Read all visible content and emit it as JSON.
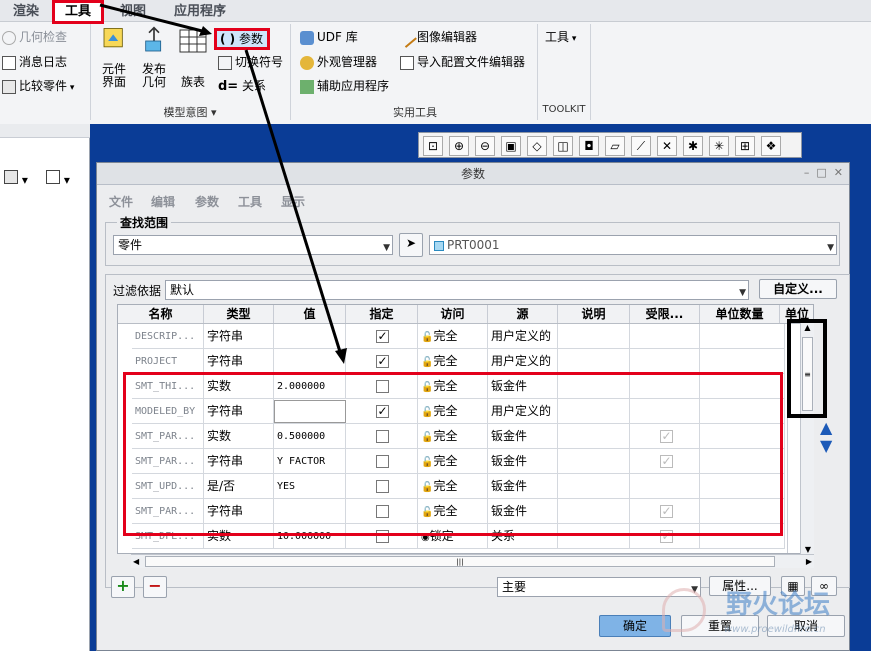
{
  "ribbon": {
    "tabs": [
      {
        "label": "渲染"
      },
      {
        "label": "工具"
      },
      {
        "label": "视图"
      },
      {
        "label": "应用程序"
      }
    ],
    "investigate": {
      "items": [
        {
          "label": "几何检查"
        },
        {
          "label": "消息日志"
        },
        {
          "label": "比较零件"
        }
      ]
    },
    "model_intent": {
      "buttons": [
        {
          "label": "元件\n界面"
        },
        {
          "label": "发布\n几何"
        },
        {
          "label": "族表"
        }
      ],
      "small": [
        {
          "label": "参数"
        },
        {
          "label": "切换符号"
        },
        {
          "label": "关系"
        }
      ],
      "group_label": "模型意图 ▾"
    },
    "utilities": {
      "items": [
        {
          "label": "UDF 库"
        },
        {
          "label": "外观管理器"
        },
        {
          "label": "辅助应用程序"
        },
        {
          "label": "图像编辑器"
        },
        {
          "label": "导入配置文件编辑器"
        }
      ],
      "group_label": "实用工具"
    },
    "toolkit": {
      "label": "工具",
      "group_label": "TOOLKIT"
    }
  },
  "dialog": {
    "title": "参数",
    "menus": [
      {
        "label": "文件"
      },
      {
        "label": "编辑"
      },
      {
        "label": "参数"
      },
      {
        "label": "工具"
      },
      {
        "label": "显示"
      }
    ],
    "lookin": {
      "label": "查找范围",
      "type_value": "零件",
      "model_value": "PRT0001"
    },
    "filter": {
      "label": "过滤依据",
      "value": "默认",
      "customize": "自定义..."
    },
    "columns": [
      {
        "label": "名称"
      },
      {
        "label": "类型"
      },
      {
        "label": "值"
      },
      {
        "label": "指定"
      },
      {
        "label": "访问"
      },
      {
        "label": "源"
      },
      {
        "label": "说明"
      },
      {
        "label": "受限..."
      },
      {
        "label": "单位数量"
      },
      {
        "label": "单位"
      }
    ],
    "rows": [
      {
        "name": "DESCRIP...",
        "type": "字符串",
        "value": "",
        "designated": true,
        "access": "完全",
        "source": "用户定义的",
        "restricted": false
      },
      {
        "name": "PROJECT",
        "type": "字符串",
        "value": "",
        "designated": true,
        "access": "完全",
        "source": "用户定义的",
        "restricted": false
      },
      {
        "name": "SMT_THI...",
        "type": "实数",
        "value": "2.000000",
        "designated": false,
        "access": "完全",
        "source": "钣金件",
        "restricted": false
      },
      {
        "name": "MODELED_BY",
        "type": "字符串",
        "value": "",
        "designated": true,
        "access": "完全",
        "source": "用户定义的",
        "restricted": false
      },
      {
        "name": "SMT_PAR...",
        "type": "实数",
        "value": "0.500000",
        "designated": false,
        "access": "完全",
        "source": "钣金件",
        "restricted": true
      },
      {
        "name": "SMT_PAR...",
        "type": "字符串",
        "value": "Y FACTOR",
        "designated": false,
        "access": "完全",
        "source": "钣金件",
        "restricted": true
      },
      {
        "name": "SMT_UPD...",
        "type": "是/否",
        "value": "YES",
        "designated": false,
        "access": "完全",
        "source": "钣金件",
        "restricted": false
      },
      {
        "name": "SMT_PAR...",
        "type": "字符串",
        "value": "",
        "designated": false,
        "access": "完全",
        "source": "钣金件",
        "restricted": true
      },
      {
        "name": "SMT_DFL...",
        "type": "实数",
        "value": "10.000000",
        "designated": false,
        "access": "锁定",
        "source": "关系",
        "restricted": true
      }
    ],
    "bottom": {
      "main_value": "主要",
      "properties": "属性..."
    },
    "footer": {
      "ok": "确定",
      "reset": "重置",
      "cancel": "取消"
    }
  },
  "watermark": {
    "text": "野火论坛",
    "url": "www.proewildfire.cn"
  },
  "colors": {
    "annotation_red": "#e3001b",
    "dialog_bg": "#ecedef",
    "desktop_blue": "#0a3c96"
  }
}
